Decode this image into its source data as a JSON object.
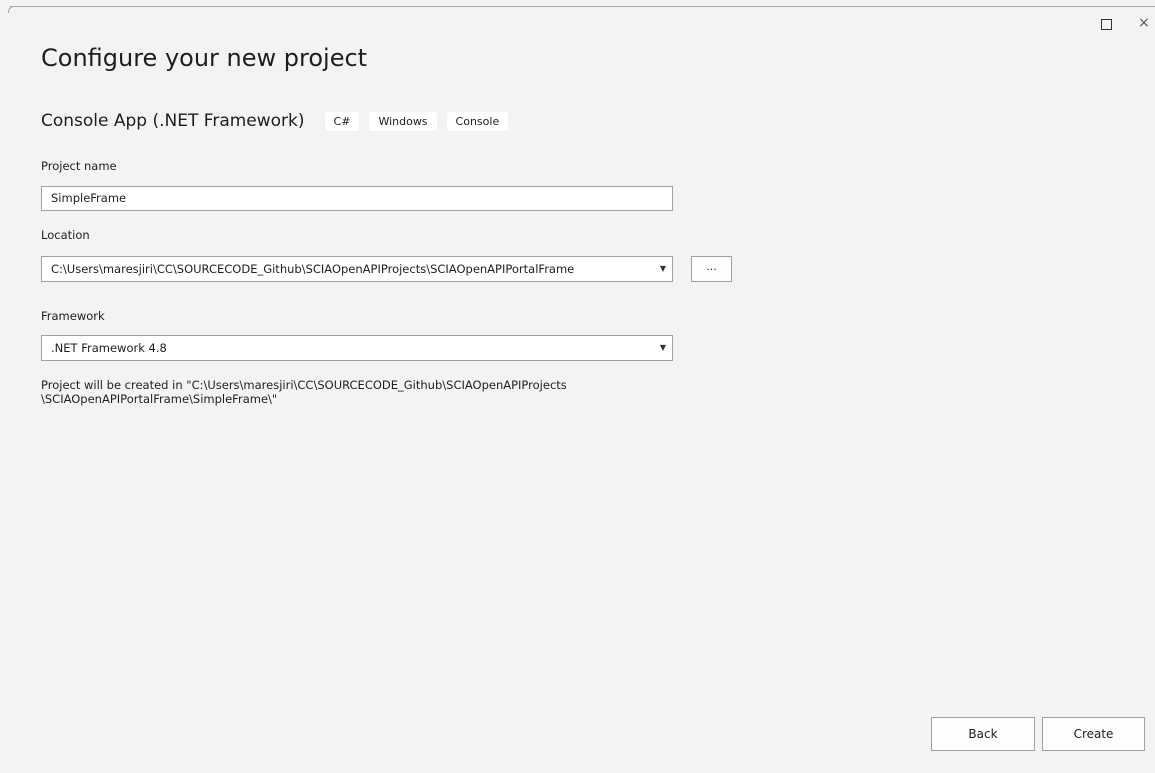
{
  "window": {
    "maximize_icon": "maximize-icon",
    "close_glyph": "×"
  },
  "page": {
    "title": "Configure your new project"
  },
  "template": {
    "name": "Console App (.NET Framework)",
    "tags": [
      "C#",
      "Windows",
      "Console"
    ]
  },
  "project_name": {
    "label": "Project name",
    "value": "SimpleFrame"
  },
  "location": {
    "label": "Location",
    "value": "C:\\Users\\maresjiri\\CC\\SOURCECODE_Github\\SCIAOpenAPIProjects\\SCIAOpenAPIPortalFrame",
    "browse_label": "..."
  },
  "framework": {
    "label": "Framework",
    "value": ".NET Framework 4.8"
  },
  "info": {
    "line1": "Project will be created in \"C:\\Users\\maresjiri\\CC\\SOURCECODE_Github\\SCIAOpenAPIProjects",
    "line2": "\\SCIAOpenAPIPortalFrame\\SimpleFrame\\\""
  },
  "footer": {
    "back_label": "Back",
    "create_label": "Create"
  },
  "colors": {
    "background": "#f3f3f3",
    "field_border": "#a0a0a0",
    "field_bg": "#ffffff"
  }
}
